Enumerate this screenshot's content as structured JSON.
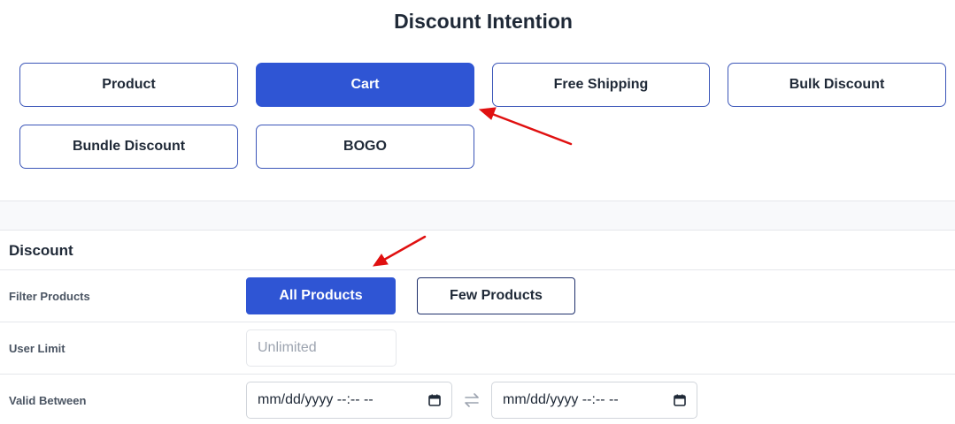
{
  "title": "Discount Intention",
  "intentions": [
    {
      "label": "Product",
      "active": false
    },
    {
      "label": "Cart",
      "active": true
    },
    {
      "label": "Free Shipping",
      "active": false
    },
    {
      "label": "Bulk Discount",
      "active": false
    },
    {
      "label": "Bundle Discount",
      "active": false
    },
    {
      "label": "BOGO",
      "active": false
    }
  ],
  "discount": {
    "section_title": "Discount",
    "filter_products": {
      "label": "Filter Products",
      "options": [
        "All Products",
        "Few Products"
      ],
      "selected": "All Products"
    },
    "user_limit": {
      "label": "User Limit",
      "placeholder": "Unlimited",
      "value": ""
    },
    "valid_between": {
      "label": "Valid Between",
      "start_placeholder": "mm/dd/yyyy --:-- --",
      "end_placeholder": "mm/dd/yyyy --:-- --"
    }
  },
  "colors": {
    "accent": "#2f55d4",
    "border": "#3b56b8",
    "annotation_arrow": "#e01010"
  },
  "icons": {
    "calendar": "calendar-icon",
    "swap": "swap-arrows-icon"
  }
}
